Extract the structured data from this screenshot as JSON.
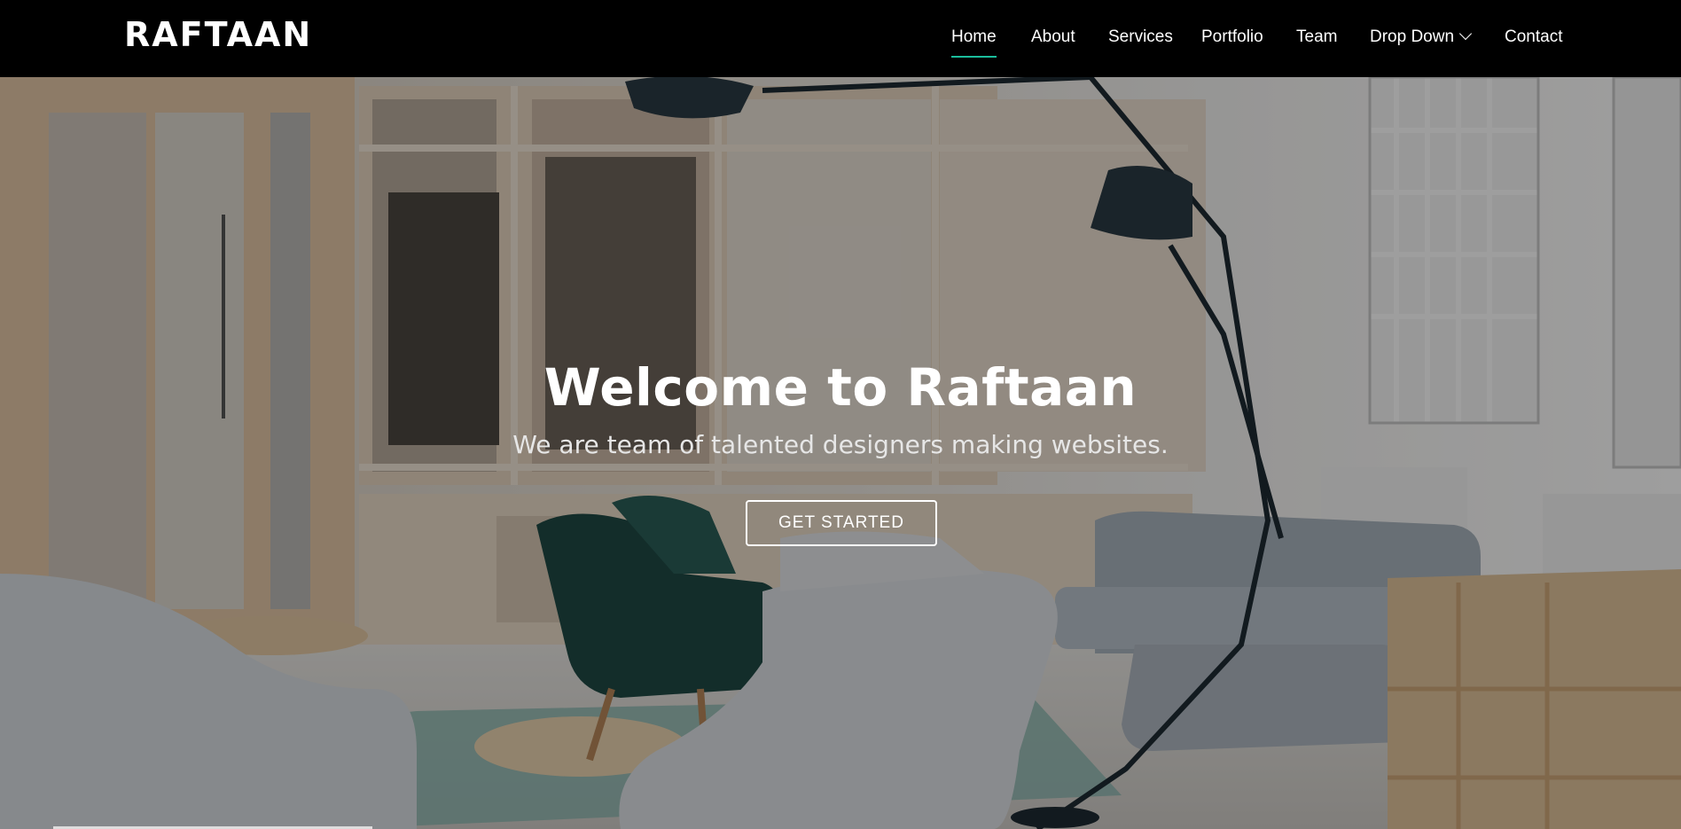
{
  "brand": {
    "logo_text": "RAFTAAN"
  },
  "nav": {
    "items": [
      {
        "label": "Home",
        "active": true
      },
      {
        "label": "About"
      },
      {
        "label": "Services"
      },
      {
        "label": "Portfolio"
      },
      {
        "label": "Team"
      },
      {
        "label": "Drop Down",
        "has_dropdown": true
      },
      {
        "label": "Contact"
      }
    ]
  },
  "hero": {
    "title": "Welcome to Raftaan",
    "subtitle": "We are team of talented designers making websites.",
    "cta_label": "GET STARTED"
  },
  "colors": {
    "header_bg": "#000000",
    "accent": "#1bbd9c",
    "text": "#ffffff"
  },
  "icons": {
    "dropdown": "chevron-down-icon"
  }
}
